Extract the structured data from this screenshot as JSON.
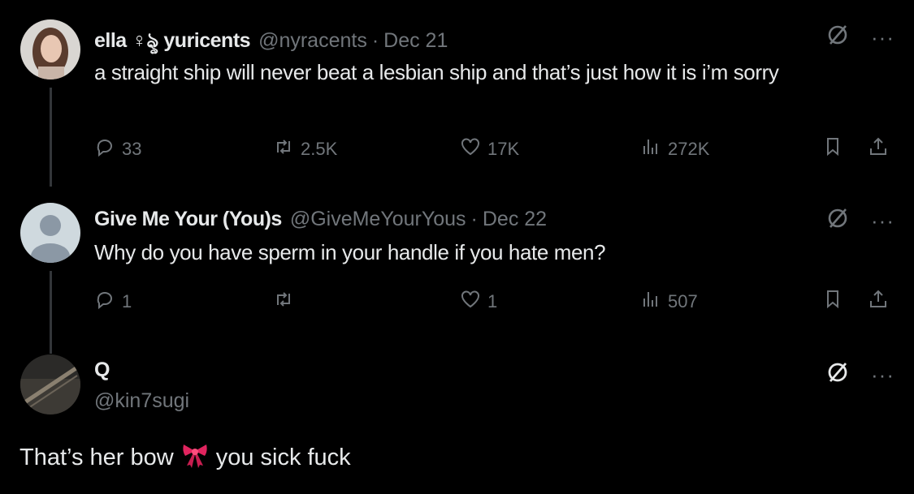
{
  "tweets": [
    {
      "name": "ella ♀︎ৡ yuricents",
      "handle": "@nyracents",
      "date": "Dec 21",
      "text": "a straight ship will never beat a lesbian ship and that’s just how it is i’m sorry",
      "replies": "33",
      "reposts": "2.5K",
      "likes": "17K",
      "views": "272K"
    },
    {
      "name": "Give Me Your (You)s",
      "handle": "@GiveMeYourYous",
      "date": "Dec 22",
      "text": "Why do you have sperm in your handle if you hate men?",
      "replies": "1",
      "reposts": "",
      "likes": "1",
      "views": "507"
    }
  ],
  "reply": {
    "name": "Q",
    "handle": "@kin7sugi",
    "text_before": "That’s her bow",
    "emoji": "🎀",
    "text_after": "you sick fuck"
  },
  "ui": {
    "separator_dot": "·",
    "more_glyph": "···"
  },
  "colors": {
    "background": "#000000",
    "primary_text": "#e7e9ea",
    "secondary_text": "#71767b",
    "thread_line": "#333639",
    "bow": "#e0245e"
  }
}
